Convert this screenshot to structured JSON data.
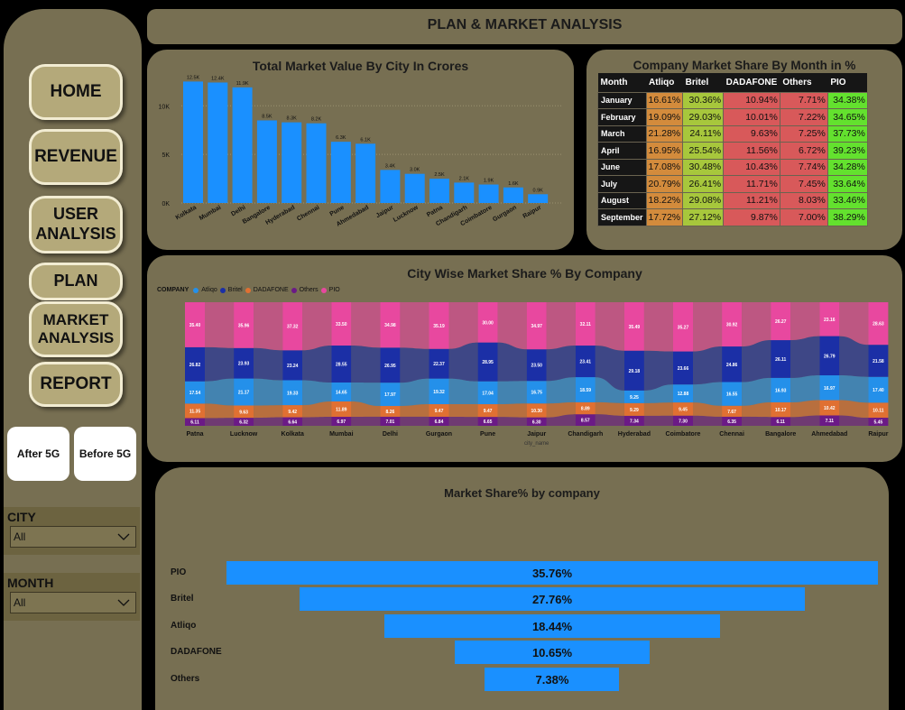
{
  "header": {
    "title": "PLAN & MARKET ANALYSIS"
  },
  "nav": {
    "home": "HOME",
    "revenue": "REVENUE",
    "user_analysis": "USER\nANALYSIS",
    "plan": "PLAN",
    "market_analysis": "MARKET\nANALYSIS",
    "report": "REPORT",
    "after_5g": "After 5G",
    "before_5g": "Before 5G"
  },
  "filters": {
    "city": {
      "label": "CITY",
      "value": "All"
    },
    "month": {
      "label": "MONTH",
      "value": "All"
    }
  },
  "colors": {
    "bar": "#1a90ff",
    "atliqo": "#2490ea",
    "britel": "#1b2fa6",
    "dadafone": "#e07032",
    "others": "#6b1a86",
    "pio": "#e8489f",
    "cell_orange": "#d38b3c",
    "cell_lightgreen": "#a7c73c",
    "cell_red": "#d8595a",
    "cell_green": "#63e12e"
  },
  "market_share_table": {
    "title": "Company Market Share By Month in %",
    "columns": [
      "Month",
      "Atliqo",
      "Britel",
      "DADAFONE",
      "Others",
      "PIO"
    ],
    "rows": [
      [
        "January",
        "16.61%",
        "30.36%",
        "10.94%",
        "7.71%",
        "34.38%"
      ],
      [
        "February",
        "19.09%",
        "29.03%",
        "10.01%",
        "7.22%",
        "34.65%"
      ],
      [
        "March",
        "21.28%",
        "24.11%",
        "9.63%",
        "7.25%",
        "37.73%"
      ],
      [
        "April",
        "16.95%",
        "25.54%",
        "11.56%",
        "6.72%",
        "39.23%"
      ],
      [
        "June",
        "17.08%",
        "30.48%",
        "10.43%",
        "7.74%",
        "34.28%"
      ],
      [
        "July",
        "20.79%",
        "26.41%",
        "11.71%",
        "7.45%",
        "33.64%"
      ],
      [
        "August",
        "18.22%",
        "29.08%",
        "11.21%",
        "8.03%",
        "33.46%"
      ],
      [
        "September",
        "17.72%",
        "27.12%",
        "9.87%",
        "7.00%",
        "38.29%"
      ]
    ]
  },
  "chart_data": [
    {
      "type": "bar",
      "title": "Total Market Value By City In Crores",
      "categories": [
        "Kolkata",
        "Mumbai",
        "Delhi",
        "Bangalore",
        "Hyderabad",
        "Chennai",
        "Pune",
        "Ahmedabad",
        "Jaipur",
        "Lucknow",
        "Patna",
        "Chandigarh",
        "Coimbatore",
        "Gurgaon",
        "Raipur"
      ],
      "values": [
        12.5,
        12.4,
        11.9,
        8.5,
        8.3,
        8.2,
        6.3,
        6.1,
        3.4,
        3.0,
        2.5,
        2.1,
        1.9,
        1.6,
        0.9
      ],
      "data_labels": [
        "12.5K",
        "12.4K",
        "11.9K",
        "8.5K",
        "8.3K",
        "8.2K",
        "6.3K",
        "6.1K",
        "3.4K",
        "3.0K",
        "2.5K",
        "2.1K",
        "1.9K",
        "1.6K",
        "0.9K"
      ],
      "y_ticks": [
        "0K",
        "5K",
        "10K"
      ],
      "ylim": [
        0,
        13
      ],
      "grid": true
    },
    {
      "type": "bar",
      "stacked": "100%",
      "title": "City Wise Market Share % By Company",
      "legend_title": "COMPANY",
      "xlabel": "city_name",
      "categories": [
        "Patna",
        "Lucknow",
        "Kolkata",
        "Mumbai",
        "Delhi",
        "Gurgaon",
        "Pune",
        "Jaipur",
        "Chandigarh",
        "Hyderabad",
        "Coimbatore",
        "Chennai",
        "Bangalore",
        "Ahmedabad",
        "Raipur"
      ],
      "series": [
        {
          "name": "Others",
          "values": [
            6.11,
            6.32,
            6.64,
            6.97,
            7.01,
            6.84,
            6.65,
            6.3,
            8.57,
            7.34,
            7.3,
            6.35,
            6.11,
            7.11,
            5.45
          ]
        },
        {
          "name": "DADAFONE",
          "values": [
            11.35,
            9.63,
            9.42,
            11.89,
            8.26,
            9.47,
            9.47,
            10.3,
            8.89,
            null,
            9.45,
            7.67,
            10.17,
            10.42,
            10.11
          ]
        },
        {
          "name": "Atliqo",
          "values": [
            17.54,
            21.17,
            19.33,
            14.65,
            17.97,
            19.32,
            17.04,
            16.75,
            18.59,
            9.25,
            12.88,
            16.55,
            16.93,
            16.97,
            17.4
          ]
        },
        {
          "name": "Britel",
          "values": [
            26.82,
            23.93,
            23.24,
            28.55,
            26.95,
            22.37,
            28.95,
            23.5,
            23.41,
            29.18,
            23.66,
            24.86,
            26.11,
            26.79,
            21.58
          ]
        },
        {
          "name": "PIO",
          "values": [
            35.4,
            35.96,
            37.32,
            33.5,
            34.98,
            35.19,
            30.0,
            34.97,
            32.11,
            35.49,
            35.27,
            30.92,
            26.27,
            23.16,
            28.63
          ]
        }
      ],
      "segment_labels": {
        "Others": [
          "6.11",
          "6.32",
          "6.64",
          "6.97",
          "7.01",
          "6.84",
          "6.65",
          "6.30",
          "8.57",
          "7.34",
          "7.30",
          "6.35",
          "6.11",
          "7.11",
          "5.45"
        ],
        "DADAFONE": [
          "11.35",
          "9.63",
          "9.42",
          "11.89",
          "8.26",
          "9.47",
          "9.47",
          "10.30",
          "8.89",
          "9.29",
          "9.45",
          "7.67",
          "10.17",
          "10.42",
          "10.11"
        ],
        "Atliqo": [
          "17.54",
          "21.17",
          "19.33",
          "14.65",
          "17.97",
          "19.32",
          "17.04",
          "16.75",
          "18.59",
          "9.25",
          "12.88",
          "16.55",
          "16.93",
          "16.97",
          "17.40"
        ],
        "Britel": [
          "26.82",
          "23.93",
          "23.24",
          "28.55",
          "26.95",
          "22.37",
          "28.95",
          "23.50",
          "23.41",
          "29.18",
          "23.66",
          "24.86",
          "26.11",
          "26.79",
          "21.58"
        ],
        "PIO": [
          "35.40",
          "35.96",
          "37.32",
          "33.50",
          "34.98",
          "35.19",
          "30.00",
          "34.97",
          "32.11",
          "35.49",
          "35.27",
          "30.92",
          "26.27",
          "23.16",
          "28.63"
        ]
      }
    },
    {
      "type": "bar",
      "orientation": "funnel",
      "title": "Market Share% by company",
      "categories": [
        "PIO",
        "Britel",
        "Atliqo",
        "DADAFONE",
        "Others"
      ],
      "values": [
        35.76,
        27.76,
        18.44,
        10.65,
        7.38
      ],
      "data_labels": [
        "35.76%",
        "27.76%",
        "18.44%",
        "10.65%",
        "7.38%"
      ]
    }
  ]
}
